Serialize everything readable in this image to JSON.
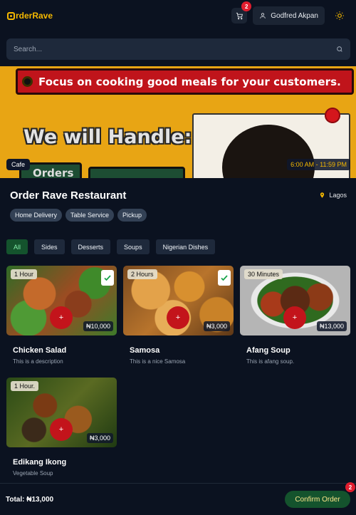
{
  "header": {
    "logo_text": "rderRave",
    "cart_count": "2",
    "user_name": "Godfred Akpan"
  },
  "search": {
    "placeholder": "Search..."
  },
  "banner": {
    "headline": "Focus on cooking good meals for your customers.",
    "subline": "We will Handle:",
    "button_text": "Orders",
    "category_tag": "Cafe",
    "hours": "6:00 AM - 11:59 PM"
  },
  "restaurant": {
    "name": "Order Rave Restaurant",
    "location": "Lagos",
    "services": [
      "Home Delivery",
      "Table Service",
      "Pickup"
    ]
  },
  "categories": [
    "All",
    "Sides",
    "Desserts",
    "Soups",
    "Nigerian Dishes"
  ],
  "menu": [
    {
      "name": "Chicken Salad",
      "description": "This is a description",
      "duration": "1 Hour",
      "price": "₦10,000",
      "add": "+",
      "selected": true
    },
    {
      "name": "Samosa",
      "description": "This is a nice Samosa",
      "duration": "2 Hours",
      "price": "₦3,000",
      "add": "+",
      "selected": true
    },
    {
      "name": "Afang Soup",
      "description": "This is afang soup.",
      "duration": "30 Minutes",
      "price": "₦13,000",
      "add": "+",
      "selected": false
    },
    {
      "name": "Edikang Ikong",
      "description": "Vegetable Soup",
      "duration": "1 Hour.",
      "price": "₦3,000",
      "add": "+",
      "selected": false
    }
  ],
  "footer": {
    "total": "Total: ₦13,000",
    "confirm_label": "Confirm Order",
    "confirm_count": "2"
  },
  "colors": {
    "background": "#0b1220",
    "brand": "#f5b800",
    "accent_red": "#c3141b",
    "active_green": "#14532d"
  }
}
